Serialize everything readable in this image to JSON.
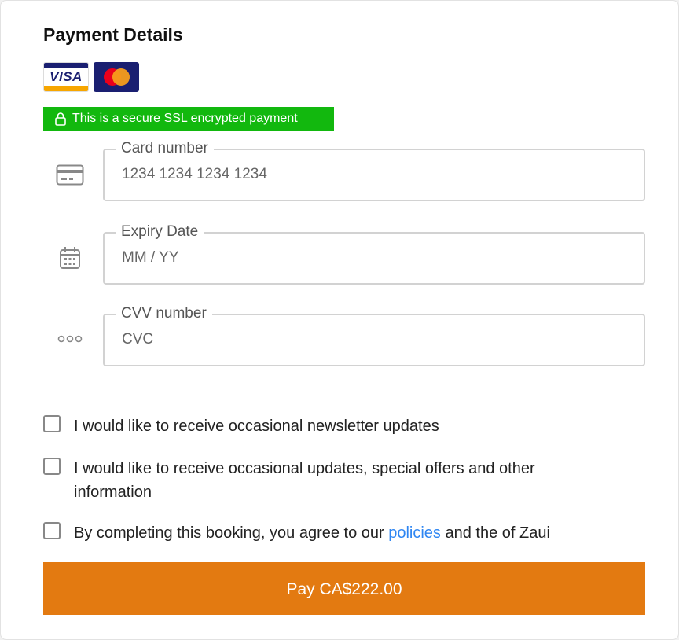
{
  "payment": {
    "title": "Payment Details",
    "cards": [
      {
        "name": "visa",
        "label": "VISA",
        "icon": "visa-logo"
      },
      {
        "name": "mastercard",
        "icon": "mastercard-logo"
      }
    ],
    "secure_badge": {
      "icon": "lock-icon",
      "text": "This is a secure SSL encrypted payment",
      "color": "#12b80e"
    },
    "fields": [
      {
        "name": "card-number",
        "label": "Card number",
        "value": "",
        "placeholder": "1234 1234 1234 1234",
        "icon": "credit-card-icon"
      },
      {
        "name": "expiry-date",
        "label": "Expiry Date",
        "value": "",
        "placeholder": "MM / YY",
        "icon": "calendar-icon"
      },
      {
        "name": "cvv",
        "label": "CVV number",
        "value": "",
        "placeholder": "CVC",
        "icon": "dots-icon"
      }
    ]
  },
  "options": {
    "newsletter": {
      "label": "I would like to receive occasional newsletter updates",
      "checked": false
    },
    "offers": {
      "label_line1": "I would like to receive occasional updates, special offers and other",
      "label_line2": "information",
      "checked": false
    },
    "terms": {
      "label_before": "By completing this booking, you agree to our ",
      "link_text": "policies",
      "label_after": " and the of Zaui",
      "checked": false
    }
  },
  "pay_button": {
    "label": "Pay CA$222.00",
    "color": "#e37a11"
  },
  "colors": {
    "link": "#2f86f2",
    "accent": "#e37a11",
    "secure": "#12b80e"
  }
}
